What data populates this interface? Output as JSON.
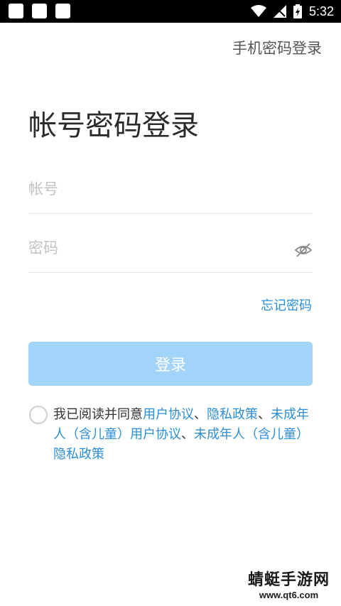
{
  "status_bar": {
    "time": "5:32",
    "icons": [
      "wifi-icon",
      "signal-icon",
      "battery-icon"
    ]
  },
  "header": {
    "switch_mode_label": "手机密码登录"
  },
  "main": {
    "title": "帐号密码登录",
    "account_placeholder": "帐号",
    "password_placeholder": "密码",
    "forgot_label": "忘记密码",
    "login_label": "登录"
  },
  "agreement": {
    "prefix": "我已阅读并同意",
    "link1": "用户协议",
    "sep1": "、",
    "link2": "隐私政策",
    "sep2": "、",
    "link3": "未成年人（含儿童）用户协议",
    "sep3": "、",
    "link4": "未成年人（含儿童）隐私政策"
  },
  "watermark": {
    "title": "蜻蜓手游网",
    "url": "www.qt6.com"
  },
  "colors": {
    "accent": "#2b8ed6",
    "button_disabled": "#a2d4fa",
    "status_bar": "#000000"
  }
}
